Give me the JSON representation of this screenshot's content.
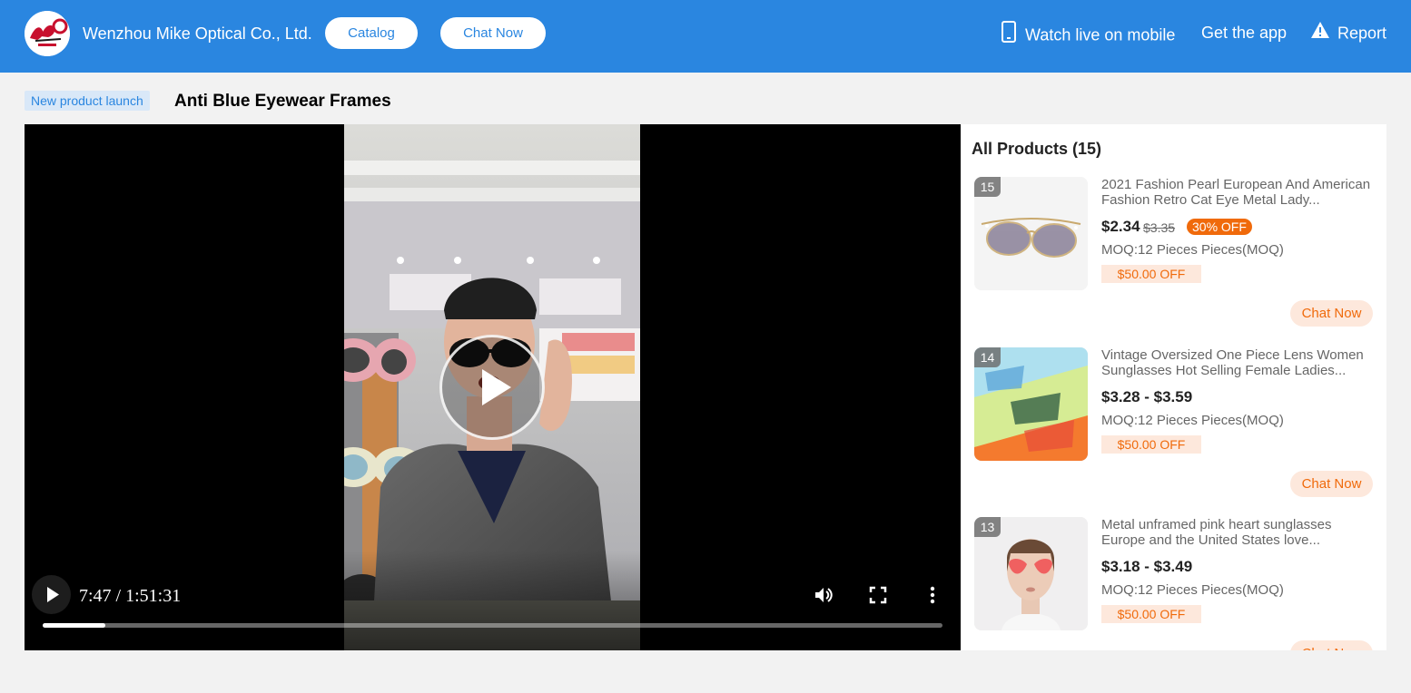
{
  "header": {
    "company_name": "Wenzhou Mike Optical Co., Ltd.",
    "catalog_label": "Catalog",
    "chat_label": "Chat Now",
    "watch_mobile_label": "Watch live on mobile",
    "get_app_label": "Get the app",
    "report_label": "Report"
  },
  "stream": {
    "tag": "New product launch",
    "title": "Anti Blue Eyewear Frames"
  },
  "player": {
    "time": "7:47 / 1:51:31",
    "progress_fraction": 0.07
  },
  "products": {
    "heading": "All Products (15)",
    "items": [
      {
        "number": "15",
        "name": "2021 Fashion Pearl European And American Fashion Retro Cat Eye Metal Lady...",
        "price": "$2.34",
        "old_price": "$3.35",
        "discount": "30% OFF",
        "moq": "MOQ:12 Pieces Pieces(MOQ)",
        "coupon": "$50.00 OFF",
        "chat_label": "Chat Now"
      },
      {
        "number": "14",
        "name": "Vintage Oversized One Piece Lens Women Sunglasses Hot Selling Female Ladies...",
        "price": "$3.28 - $3.59",
        "moq": "MOQ:12 Pieces Pieces(MOQ)",
        "coupon": "$50.00 OFF",
        "chat_label": "Chat Now"
      },
      {
        "number": "13",
        "name": "Metal unframed pink heart sunglasses Europe and the United States love...",
        "price": "$3.18 - $3.49",
        "moq": "MOQ:12 Pieces Pieces(MOQ)",
        "coupon": "$50.00 OFF",
        "chat_label": "Chat Now"
      }
    ]
  },
  "colors": {
    "header_blue": "#2a86e0",
    "discount_orange": "#f06a0b",
    "coupon_bg": "#fde8dc"
  },
  "icons": [
    "brand-logo-icon",
    "phone-icon",
    "warning-icon",
    "play-icon",
    "volume-icon",
    "fullscreen-icon",
    "more-vertical-icon"
  ]
}
